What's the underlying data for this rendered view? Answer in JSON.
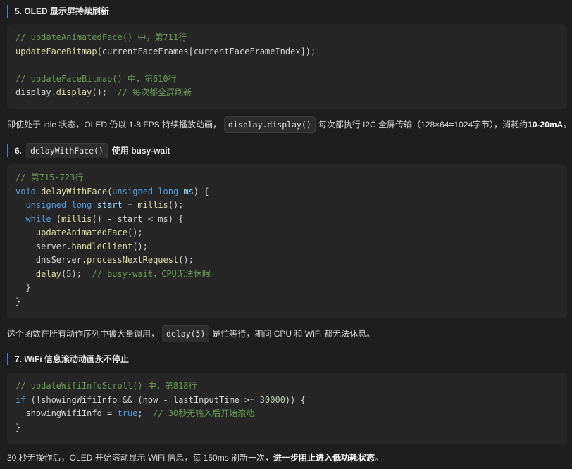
{
  "sec5": {
    "title": "5. OLED 显示屏持续刷新",
    "code": [
      [
        [
          "c",
          "// updateAnimatedFace() 中，第711行"
        ]
      ],
      [
        [
          "f",
          "updateFaceBitmap"
        ],
        [
          "p",
          "(currentFaceFrames[currentFaceFrameIndex]);"
        ]
      ],
      [
        [
          "p",
          ""
        ]
      ],
      [
        [
          "c",
          "// updateFaceBitmap() 中，第610行"
        ]
      ],
      [
        [
          "p",
          "display."
        ],
        [
          "f",
          "display"
        ],
        [
          "p",
          "();  "
        ],
        [
          "c",
          "// 每次都全屏刷新"
        ]
      ]
    ],
    "para_before": "即使处于 idle 状态，OLED 仍以 1-8 FPS 持续播放动画，",
    "para_code": "display.display()",
    "para_after": "每次都执行 I2C 全屏传输（128×64=1024字节），消耗约 ",
    "para_bold": "10-20mA",
    "para_end": "。"
  },
  "sec6": {
    "title_prefix": "6.",
    "title_code": "delayWithFace()",
    "title_suffix": "使用 busy-wait",
    "code": [
      [
        [
          "c",
          "// 第715-723行"
        ]
      ],
      [
        [
          "k",
          "void"
        ],
        [
          "p",
          " "
        ],
        [
          "f",
          "delayWithFace"
        ],
        [
          "p",
          "("
        ],
        [
          "k",
          "unsigned long"
        ],
        [
          "p",
          " "
        ],
        [
          "v",
          "ms"
        ],
        [
          "p",
          ") {"
        ]
      ],
      [
        [
          "p",
          "  "
        ],
        [
          "k",
          "unsigned long"
        ],
        [
          "p",
          " "
        ],
        [
          "v",
          "start"
        ],
        [
          "p",
          " = "
        ],
        [
          "f",
          "millis"
        ],
        [
          "p",
          "();"
        ]
      ],
      [
        [
          "p",
          "  "
        ],
        [
          "k",
          "while"
        ],
        [
          "p",
          " ("
        ],
        [
          "f",
          "millis"
        ],
        [
          "p",
          "() - start < ms) {"
        ]
      ],
      [
        [
          "p",
          "    "
        ],
        [
          "f",
          "updateAnimatedFace"
        ],
        [
          "p",
          "();"
        ]
      ],
      [
        [
          "p",
          "    server."
        ],
        [
          "f",
          "handleClient"
        ],
        [
          "p",
          "();"
        ]
      ],
      [
        [
          "p",
          "    dnsServer."
        ],
        [
          "f",
          "processNextRequest"
        ],
        [
          "p",
          "();"
        ]
      ],
      [
        [
          "p",
          "    "
        ],
        [
          "f",
          "delay"
        ],
        [
          "p",
          "("
        ],
        [
          "n",
          "5"
        ],
        [
          "p",
          ");  "
        ],
        [
          "c",
          "// busy-wait，CPU无法休眠"
        ]
      ],
      [
        [
          "p",
          "  }"
        ]
      ],
      [
        [
          "p",
          "}"
        ]
      ]
    ],
    "para_before": "这个函数在所有动作序列中被大量调用，",
    "para_code": "delay(5)",
    "para_after": "是忙等待，期间 CPU 和 WiFi 都无法休息。"
  },
  "sec7": {
    "title": "7. WiFi 信息滚动动画永不停止",
    "code": [
      [
        [
          "c",
          "// updateWifiInfoScroll() 中，第818行"
        ]
      ],
      [
        [
          "k",
          "if"
        ],
        [
          "p",
          " (!showingWifiInfo && (now - lastInputTime >= "
        ],
        [
          "n",
          "30000"
        ],
        [
          "p",
          ")) {"
        ]
      ],
      [
        [
          "p",
          "  showingWifiInfo = "
        ],
        [
          "k",
          "true"
        ],
        [
          "p",
          ";  "
        ],
        [
          "c",
          "// 30秒无输入后开始滚动"
        ]
      ],
      [
        [
          "p",
          "}"
        ]
      ]
    ],
    "para_before": "30 秒无操作后，OLED 开始滚动显示 WiFi 信息，每 150ms 刷新一次，",
    "para_bold": "进一步阻止进入低功耗状态",
    "para_end": "。"
  }
}
